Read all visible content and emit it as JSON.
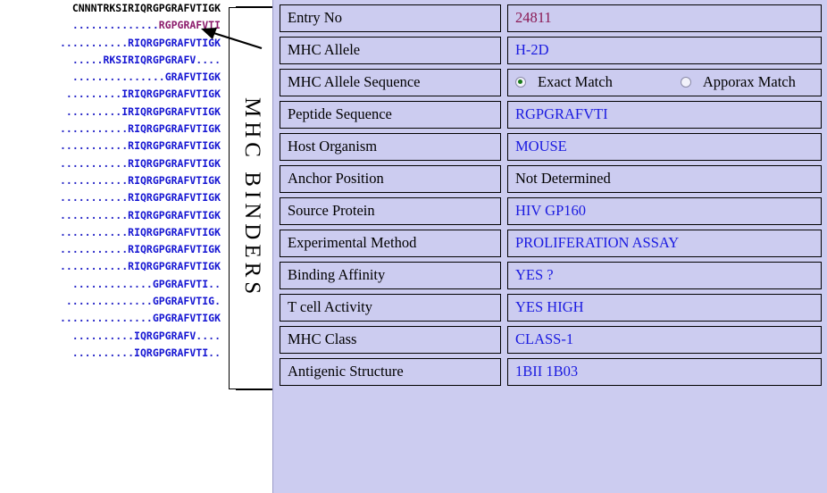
{
  "alignment": {
    "label": "MHC BINDERS",
    "rows": [
      {
        "dots_before": 0,
        "seq": "CNNNTRKSIRIQRGPGRAFVTIGK",
        "dots_after": 0,
        "style": "query"
      },
      {
        "dots_before": 14,
        "seq": "RGPGRAFVTI",
        "dots_after": 0,
        "style": "highlight"
      },
      {
        "dots_before": 11,
        "seq": "RIQRGPGRAFVTIGK",
        "dots_after": 0,
        "style": "binder"
      },
      {
        "dots_before": 5,
        "seq": "RKSIRIQRGPGRAFV",
        "dots_after": 4,
        "style": "binder"
      },
      {
        "dots_before": 15,
        "seq": "GRAFVTIGK",
        "dots_after": 0,
        "style": "binder"
      },
      {
        "dots_before": 9,
        "seq": "IRIQRGPGRAFVTIGK",
        "dots_after": 0,
        "style": "binder"
      },
      {
        "dots_before": 9,
        "seq": "IRIQRGPGRAFVTIGK",
        "dots_after": 0,
        "style": "binder"
      },
      {
        "dots_before": 11,
        "seq": "RIQRGPGRAFVTIGK",
        "dots_after": 0,
        "style": "binder"
      },
      {
        "dots_before": 11,
        "seq": "RIQRGPGRAFVTIGK",
        "dots_after": 0,
        "style": "binder"
      },
      {
        "dots_before": 11,
        "seq": "RIQRGPGRAFVTIGK",
        "dots_after": 0,
        "style": "binder"
      },
      {
        "dots_before": 11,
        "seq": "RIQRGPGRAFVTIGK",
        "dots_after": 0,
        "style": "binder"
      },
      {
        "dots_before": 11,
        "seq": "RIQRGPGRAFVTIGK",
        "dots_after": 0,
        "style": "binder"
      },
      {
        "dots_before": 11,
        "seq": "RIQRGPGRAFVTIGK",
        "dots_after": 0,
        "style": "binder"
      },
      {
        "dots_before": 11,
        "seq": "RIQRGPGRAFVTIGK",
        "dots_after": 0,
        "style": "binder"
      },
      {
        "dots_before": 11,
        "seq": "RIQRGPGRAFVTIGK",
        "dots_after": 0,
        "style": "binder"
      },
      {
        "dots_before": 11,
        "seq": "RIQRGPGRAFVTIGK",
        "dots_after": 0,
        "style": "binder"
      },
      {
        "dots_before": 13,
        "seq": "GPGRAFVTI",
        "dots_after": 2,
        "style": "binder"
      },
      {
        "dots_before": 14,
        "seq": "GPGRAFVTIG",
        "dots_after": 1,
        "style": "binder"
      },
      {
        "dots_before": 15,
        "seq": "GPGRAFVTIGK",
        "dots_after": 0,
        "style": "binder"
      },
      {
        "dots_before": 10,
        "seq": "IQRGPGRAFV",
        "dots_after": 4,
        "style": "binder"
      },
      {
        "dots_before": 10,
        "seq": "IQRGPGRAFVTI",
        "dots_after": 2,
        "style": "binder"
      }
    ]
  },
  "detail": {
    "rows": [
      {
        "label": "Entry No",
        "value": "24811",
        "value_style": "maroon"
      },
      {
        "label": "MHC Allele",
        "value": "H-2D",
        "value_style": "link"
      },
      {
        "label": "MHC Allele Sequence",
        "value": "",
        "value_style": "radio"
      },
      {
        "label": "Peptide Sequence",
        "value": "RGPGRAFVTI",
        "value_style": "link"
      },
      {
        "label": "Host Organism",
        "value": "MOUSE",
        "value_style": "link"
      },
      {
        "label": "Anchor Position",
        "value": "Not Determined",
        "value_style": "plain"
      },
      {
        "label": "Source Protein",
        "value": "HIV GP160",
        "value_style": "link"
      },
      {
        "label": "Experimental Method",
        "value": "PROLIFERATION ASSAY",
        "value_style": "link"
      },
      {
        "label": "Binding Affinity",
        "value": "YES ?",
        "value_style": "link"
      },
      {
        "label": "T cell Activity",
        "value": "YES HIGH",
        "value_style": "link"
      },
      {
        "label": "MHC Class",
        "value": "CLASS-1",
        "value_style": "link"
      },
      {
        "label": "Antigenic Structure",
        "value": "1BII 1B03",
        "value_style": "link"
      }
    ],
    "radio": {
      "exact_label": "Exact Match",
      "approx_label": "Apporax Match",
      "selected": "exact"
    }
  },
  "colors": {
    "panel_background": "#ccccf0",
    "link_text": "#1a1ae0",
    "entry_text": "#8b1a55",
    "binder_text": "#1414d2",
    "highlight_text": "#8b1a6b",
    "radio_dot": "#1a7a1a"
  }
}
